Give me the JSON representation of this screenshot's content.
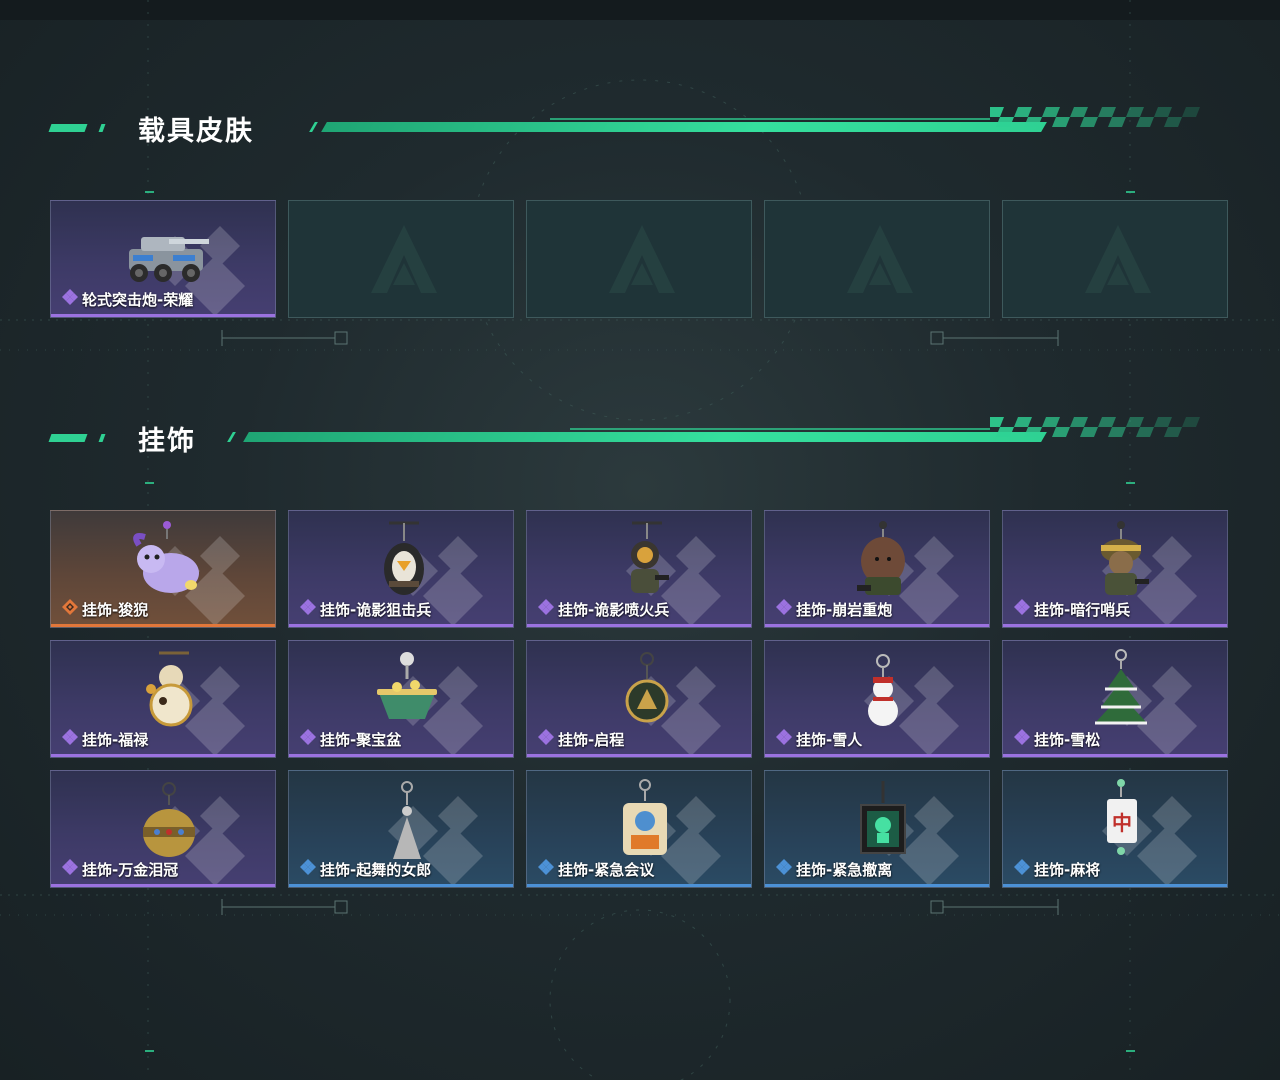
{
  "sections": {
    "vehicle_skins": {
      "title": "载具皮肤"
    },
    "pendants": {
      "title": "挂饰"
    }
  },
  "vehicle_cards": [
    {
      "label": "轮式突击炮-荣耀",
      "rarity": "purple",
      "icon": "armored-vehicle-icon"
    },
    {
      "label": "",
      "rarity": "empty",
      "icon": "placeholder-logo-icon"
    },
    {
      "label": "",
      "rarity": "empty",
      "icon": "placeholder-logo-icon"
    },
    {
      "label": "",
      "rarity": "empty",
      "icon": "placeholder-logo-icon"
    },
    {
      "label": "",
      "rarity": "empty",
      "icon": "placeholder-logo-icon"
    }
  ],
  "pendant_cards": [
    {
      "label": "挂饰-狻猊",
      "rarity": "orange",
      "icon": "suanni-pendant-icon"
    },
    {
      "label": "挂饰-诡影狙击兵",
      "rarity": "purple",
      "icon": "sniper-pendant-icon"
    },
    {
      "label": "挂饰-诡影喷火兵",
      "rarity": "purple",
      "icon": "flamethrower-pendant-icon"
    },
    {
      "label": "挂饰-崩岩重炮",
      "rarity": "purple",
      "icon": "heavy-gunner-pendant-icon"
    },
    {
      "label": "挂饰-暗行哨兵",
      "rarity": "purple",
      "icon": "sentinel-pendant-icon"
    },
    {
      "label": "挂饰-福禄",
      "rarity": "purple",
      "icon": "gourd-pendant-icon"
    },
    {
      "label": "挂饰-聚宝盆",
      "rarity": "purple",
      "icon": "treasure-bowl-pendant-icon"
    },
    {
      "label": "挂饰-启程",
      "rarity": "purple",
      "icon": "medallion-pendant-icon"
    },
    {
      "label": "挂饰-雪人",
      "rarity": "purple",
      "icon": "snowman-pendant-icon"
    },
    {
      "label": "挂饰-雪松",
      "rarity": "purple",
      "icon": "pine-tree-pendant-icon"
    },
    {
      "label": "挂饰-万金泪冠",
      "rarity": "purple",
      "icon": "crown-pendant-icon"
    },
    {
      "label": "挂饰-起舞的女郎",
      "rarity": "blue",
      "icon": "dancer-pendant-icon"
    },
    {
      "label": "挂饰-紧急会议",
      "rarity": "blue",
      "icon": "meeting-pendant-icon"
    },
    {
      "label": "挂饰-紧急撤离",
      "rarity": "blue",
      "icon": "evacuation-pendant-icon"
    },
    {
      "label": "挂饰-麻将",
      "rarity": "blue",
      "icon": "mahjong-pendant-icon"
    }
  ],
  "colors": {
    "accent_green": "#2fd193",
    "rarity_purple": "#9b72e0",
    "rarity_orange": "#e2773a",
    "rarity_blue": "#4c91d6"
  }
}
